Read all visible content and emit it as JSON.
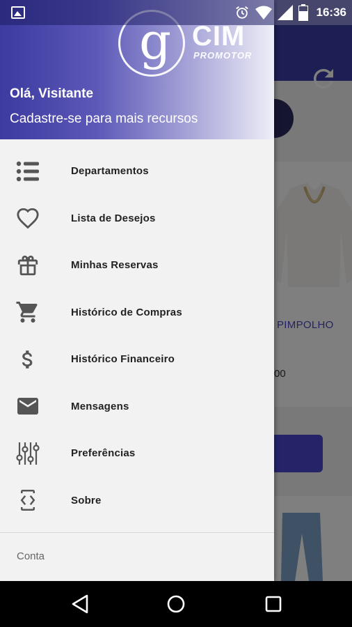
{
  "status_bar": {
    "time": "16:36",
    "icons": [
      "gallery-icon",
      "alarm-icon",
      "wifi-icon",
      "signal-icon",
      "battery-icon"
    ]
  },
  "background": {
    "product_name": "PIMPOLHO",
    "price_fragment": "00"
  },
  "drawer": {
    "logo": {
      "text": "CIM",
      "subtext": "PROMOTOR"
    },
    "greeting": "Olá, Visitante",
    "subtitle": "Cadastre-se para mais recursos",
    "items": [
      {
        "label": "Departamentos",
        "icon": "list-icon"
      },
      {
        "label": "Lista de Desejos",
        "icon": "heart-icon"
      },
      {
        "label": "Minhas Reservas",
        "icon": "gift-icon"
      },
      {
        "label": "Histórico de Compras",
        "icon": "cart-icon"
      },
      {
        "label": "Histórico Financeiro",
        "icon": "dollar-icon"
      },
      {
        "label": "Mensagens",
        "icon": "mail-icon"
      },
      {
        "label": "Preferências",
        "icon": "sliders-icon"
      },
      {
        "label": "Sobre",
        "icon": "developer-mode-icon"
      }
    ],
    "section_label": "Conta"
  },
  "colors": {
    "primary": "#3b3ca8",
    "accent": "#4a48d0",
    "icon": "#555555"
  }
}
